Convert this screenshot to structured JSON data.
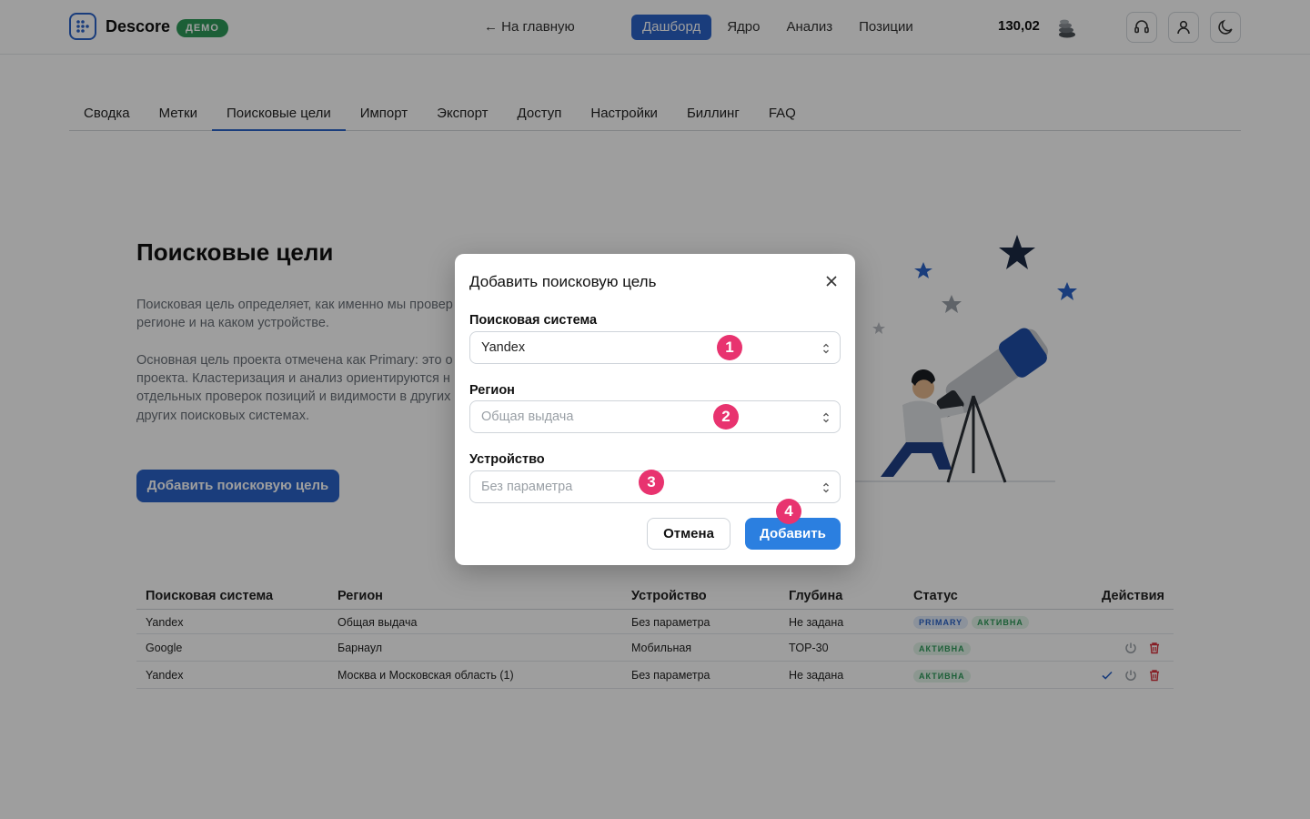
{
  "header": {
    "logo_name": "Descore",
    "demo_badge": "ДЕМО",
    "back_link": "← На главную",
    "nav": [
      {
        "label": "Дашборд",
        "active": true
      },
      {
        "label": "Ядро",
        "active": false
      },
      {
        "label": "Анализ",
        "active": false
      },
      {
        "label": "Позиции",
        "active": false
      }
    ],
    "balance": "130,02"
  },
  "tabs": [
    {
      "label": "Сводка",
      "active": false
    },
    {
      "label": "Метки",
      "active": false
    },
    {
      "label": "Поисковые цели",
      "active": true
    },
    {
      "label": "Импорт",
      "active": false
    },
    {
      "label": "Экспорт",
      "active": false
    },
    {
      "label": "Доступ",
      "active": false
    },
    {
      "label": "Настройки",
      "active": false
    },
    {
      "label": "Биллинг",
      "active": false
    },
    {
      "label": "FAQ",
      "active": false
    }
  ],
  "hero": {
    "title": "Поисковые цели",
    "paragraph1_line1": "Поисковая цель определяет, как именно мы провер",
    "paragraph1_line2": "регионе и на каком устройстве.",
    "paragraph2_line1": "Основная цель проекта отмечена как Primary: это о",
    "paragraph2_line2": "проекта. Кластеризация и анализ ориентируются н",
    "paragraph2_line3": "отдельных проверок позиций и видимости в других",
    "paragraph2_line4": "других поисковых системах.",
    "add_button": "Добавить поисковую цель"
  },
  "table": {
    "headers": [
      "Поисковая система",
      "Регион",
      "Устройство",
      "Глубина",
      "Статус",
      "Действия"
    ],
    "rows": [
      {
        "engine": "Yandex",
        "region": "Общая выдача",
        "device": "Без параметра",
        "depth": "Не задана",
        "primary": "PRIMARY",
        "status": "АКТИВНА"
      },
      {
        "engine": "Google",
        "region": "Барнаул",
        "device": "Мобильная",
        "depth": "TOP-30",
        "primary": "",
        "status": "АКТИВНА"
      },
      {
        "engine": "Yandex",
        "region": "Москва и Московская область (1)",
        "device": "Без параметра",
        "depth": "Не задана",
        "primary": "",
        "status": "АКТИВНА"
      }
    ]
  },
  "modal": {
    "title": "Добавить поисковую цель",
    "engine_label": "Поисковая система",
    "engine_value": "Yandex",
    "region_label": "Регион",
    "region_placeholder": "Общая выдача",
    "device_label": "Устройство",
    "device_placeholder": "Без параметра",
    "cancel": "Отмена",
    "add": "Добавить"
  },
  "markers": [
    "1",
    "2",
    "3",
    "4"
  ],
  "colors": {
    "brand": "#2b63c9",
    "add_button": "#2b7fe0",
    "demo_badge": "#2e9a5a",
    "marker": "#e8336f",
    "delete": "#d9303a"
  },
  "icons": [
    "logo-grid-icon",
    "coin-stack-icon",
    "headset-icon",
    "user-icon",
    "moon-icon",
    "close-icon",
    "chevron-updown-icon",
    "power-icon",
    "trash-icon",
    "check-icon"
  ]
}
